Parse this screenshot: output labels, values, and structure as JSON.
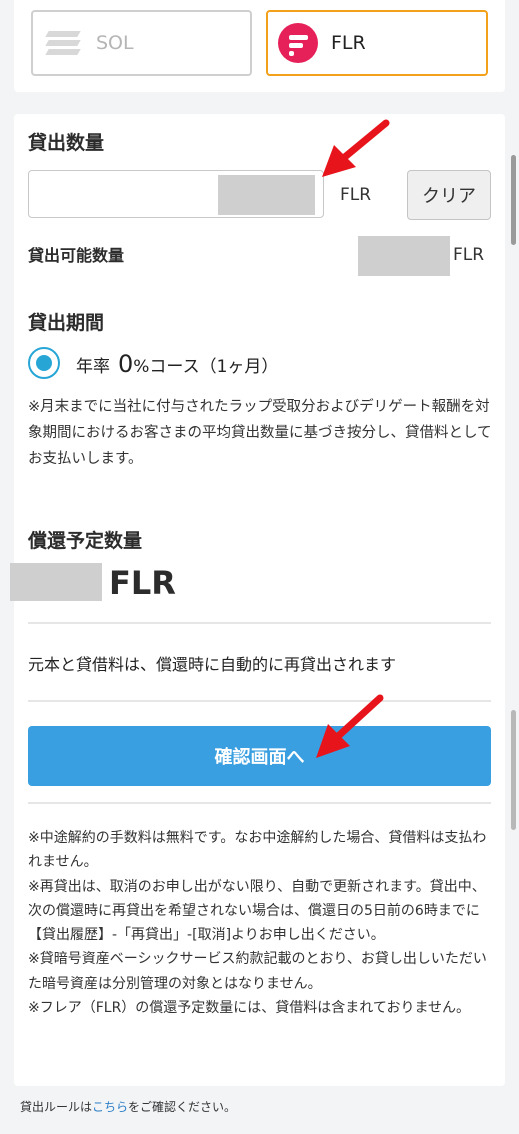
{
  "assets": {
    "sol": {
      "label": "SOL",
      "icon": "solana-logo-icon",
      "selected": false
    },
    "flr": {
      "label": "FLR",
      "icon": "flare-logo-icon",
      "selected": true,
      "accent": "#f2a11a",
      "logo_color": "#e62058"
    }
  },
  "lend": {
    "amount_title": "貸出数量",
    "amount_value": "",
    "amount_unit": "FLR",
    "clear_label": "クリア",
    "available_label": "貸出可能数量",
    "available_unit": "FLR",
    "period_title": "貸出期間",
    "course_prefix": "年率",
    "course_rate": "0",
    "course_suffix": "%コース（1ヶ月）",
    "period_note": "※月末までに当社に付与されたラップ受取分およびデリゲート報酬を対象期間におけるお客さまの平均貸出数量に基づき按分し、貸借料としてお支払いします。",
    "repay_title": "償還予定数量",
    "repay_unit": "FLR",
    "auto_relend_note": "元本と貸借料は、償還時に自動的に再貸出されます",
    "confirm_label": "確認画面へ"
  },
  "notes": [
    "※中途解約の手数料は無料です。なお中途解約した場合、貸借料は支払われません。",
    "※再貸出は、取消のお申し出がない限り、自動で更新されます。貸出中、次の償還時に再貸出を希望されない場合は、償還日の5日前の6時までに【貸出履歴】-「再貸出」-[取消]よりお申し出ください。",
    "※貸暗号資産ベーシックサービス約款記載のとおり、お貸し出しいただいた暗号資産は分別管理の対象とはなりません。",
    "※フレア（FLR）の償還予定数量には、貸借料は含まれておりません。"
  ],
  "footer": {
    "prefix": "貸出ルールは",
    "link": "こちら",
    "suffix": "をご確認ください。"
  },
  "colors": {
    "primary_button": "#3a9fe0",
    "radio": "#27a6d6",
    "annotation_arrow": "#e8141c"
  }
}
